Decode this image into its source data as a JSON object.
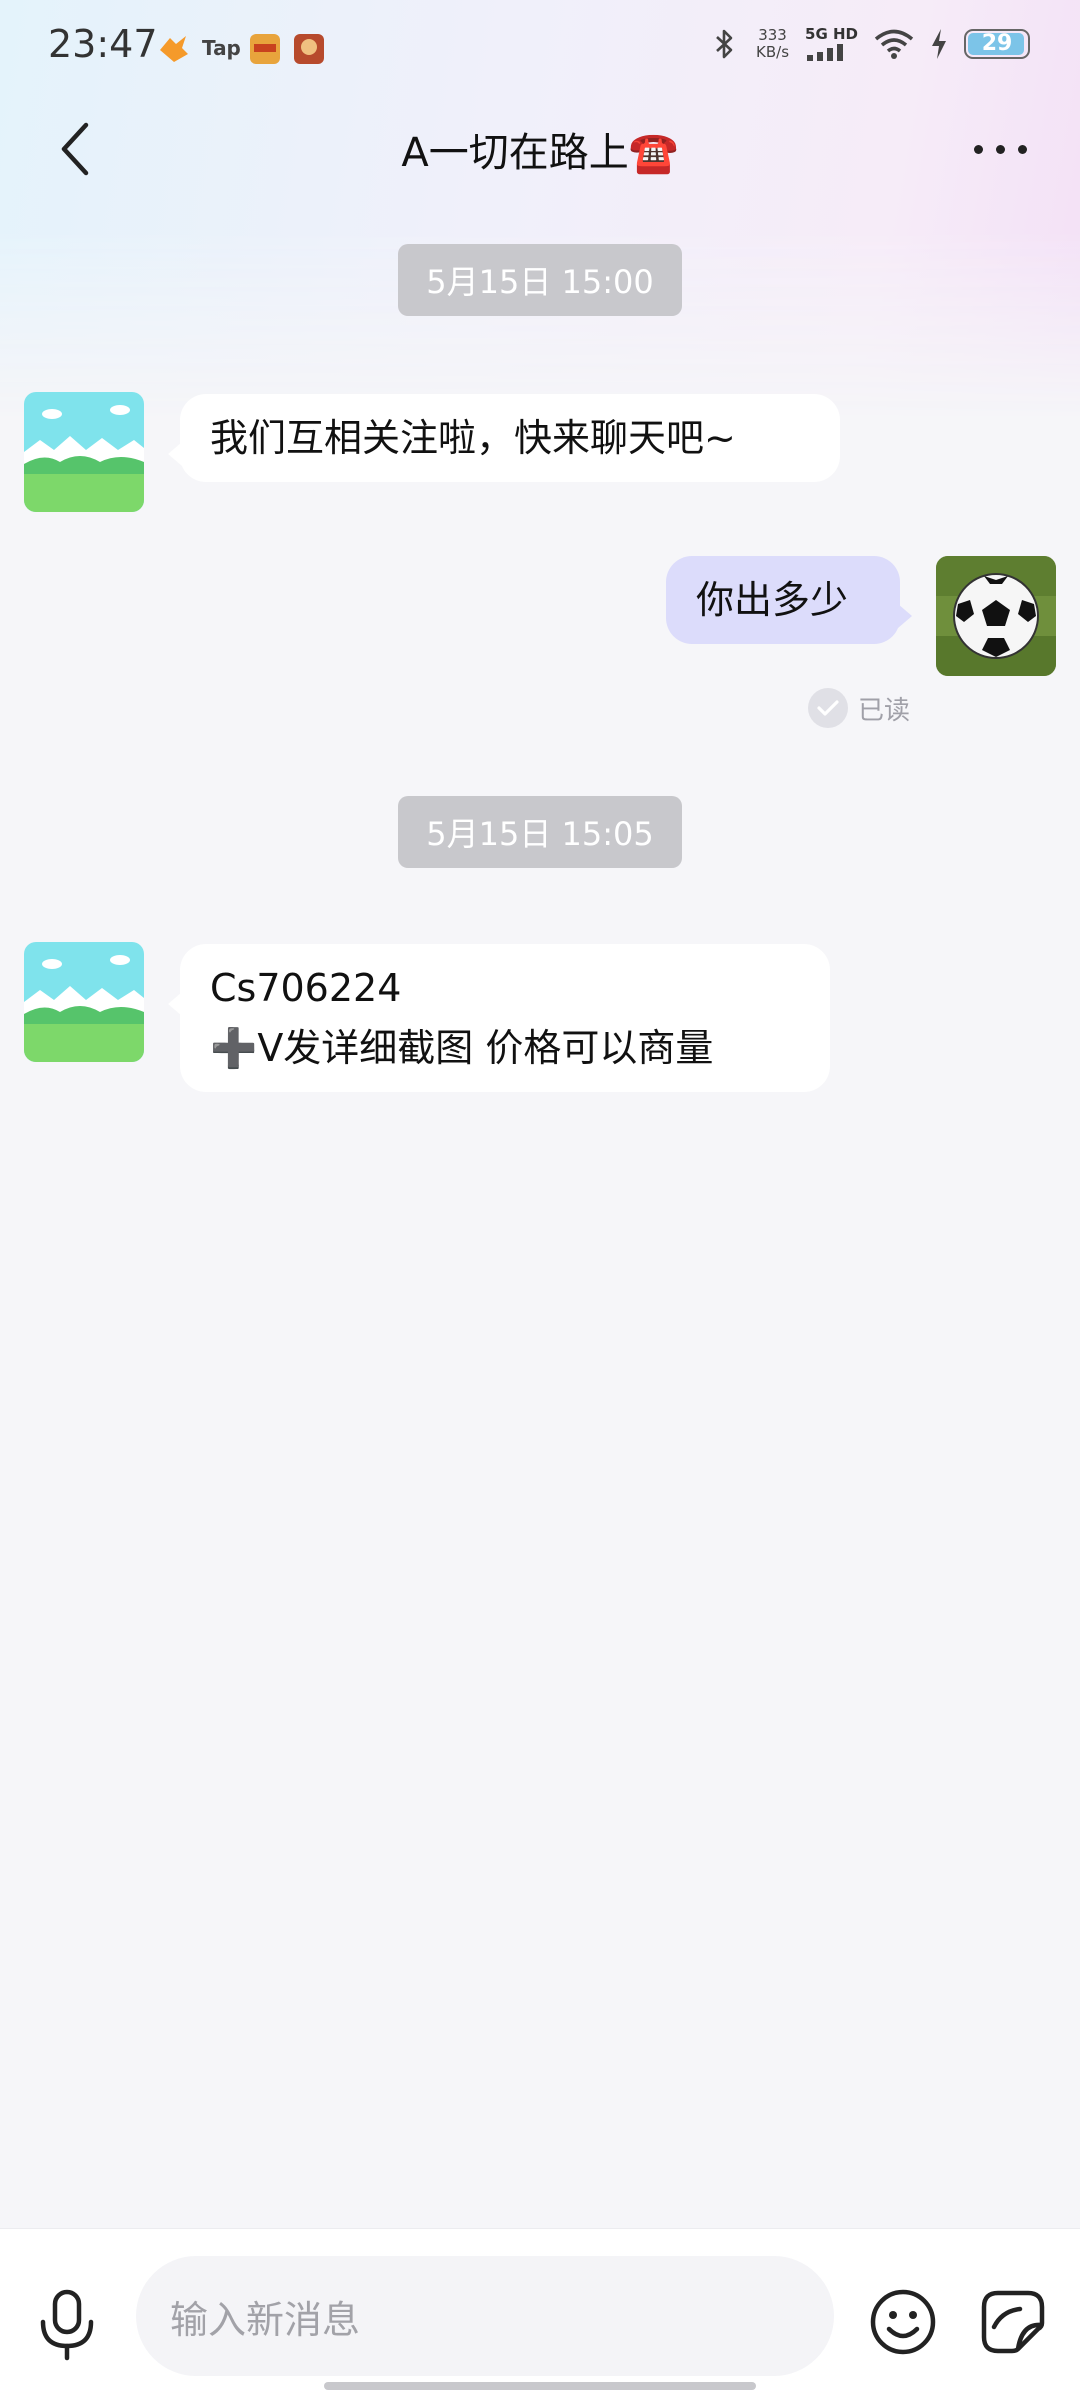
{
  "status_bar": {
    "time": "23:47",
    "tap_label": "Tap",
    "net_speed_value": "333",
    "net_speed_unit": "KB/s",
    "network_type": "5G HD",
    "battery_level": "29",
    "battery_fraction": 0.29
  },
  "header": {
    "title": "A一切在路上☎️"
  },
  "messages": [
    {
      "timestamp": "5月15日 15:00",
      "direction": "in",
      "text": "我们互相关注啦，快来聊天吧~"
    },
    {
      "direction": "out",
      "text": "你出多少",
      "read_status": "已读"
    },
    {
      "timestamp": "5月15日 15:05",
      "direction": "in",
      "lines": [
        "Cs706224",
        "➕V发详细截图  价格可以商量"
      ]
    }
  ],
  "input": {
    "placeholder": "输入新消息"
  },
  "colors": {
    "incoming_bubble": "#ffffff",
    "outgoing_bubble": "#dcdcfb",
    "timestamp_bg": "#c8c8cc",
    "background": "#f6f6f9"
  },
  "icons": {
    "back": "chevron-left-icon",
    "more": "more-dots-icon",
    "mic": "microphone-icon",
    "emoji": "smiley-icon",
    "sticker": "sticker-icon",
    "read": "check-circle-icon"
  }
}
